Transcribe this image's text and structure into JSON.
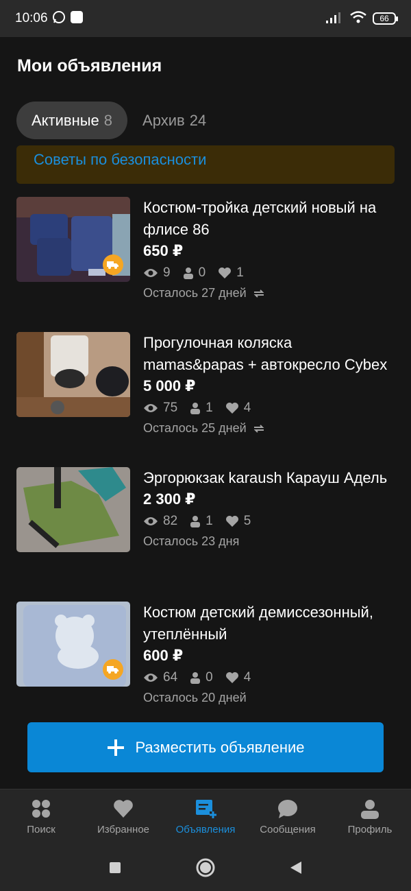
{
  "status_bar": {
    "time": "10:06",
    "battery": "66"
  },
  "page": {
    "title": "Мои объявления"
  },
  "tabs": [
    {
      "label": "Активные",
      "count": "8",
      "active": true
    },
    {
      "label": "Архив",
      "count": "24",
      "active": false
    }
  ],
  "banner": {
    "text": "Советы по безопасности"
  },
  "listings": [
    {
      "title": "Костюм-тройка детский новый на флисе 86",
      "price": "650 ₽",
      "views": "9",
      "contacts": "0",
      "favorites": "1",
      "remaining": "Осталось 27 дней",
      "delivery": true,
      "autorenew": true
    },
    {
      "title": "Прогулочная коляска mamas&papas + автокресло Cybex",
      "price": "5 000 ₽",
      "views": "75",
      "contacts": "1",
      "favorites": "4",
      "remaining": "Осталось 25 дней",
      "delivery": false,
      "autorenew": true
    },
    {
      "title": "Эргорюкзак karaush Карауш Адель",
      "price": "2 300 ₽",
      "views": "82",
      "contacts": "1",
      "favorites": "5",
      "remaining": "Осталось 23 дня",
      "delivery": false,
      "autorenew": false
    },
    {
      "title": "Костюм детский демиссезонный, утеплённый",
      "price": "600 ₽",
      "views": "64",
      "contacts": "0",
      "favorites": "4",
      "remaining": "Осталось 20 дней",
      "delivery": true,
      "autorenew": false
    }
  ],
  "post_button": {
    "label": "Разместить объявление"
  },
  "bottom_nav": [
    {
      "label": "Поиск",
      "icon": "search-icon"
    },
    {
      "label": "Избранное",
      "icon": "heart-icon"
    },
    {
      "label": "Объявления",
      "icon": "listings-icon",
      "active": true
    },
    {
      "label": "Сообщения",
      "icon": "chat-icon"
    },
    {
      "label": "Профиль",
      "icon": "profile-icon"
    }
  ],
  "colors": {
    "accent": "#0a87d6",
    "link": "#1b8fdc",
    "badge": "#f5a623",
    "banner_bg": "#3b2c07"
  }
}
